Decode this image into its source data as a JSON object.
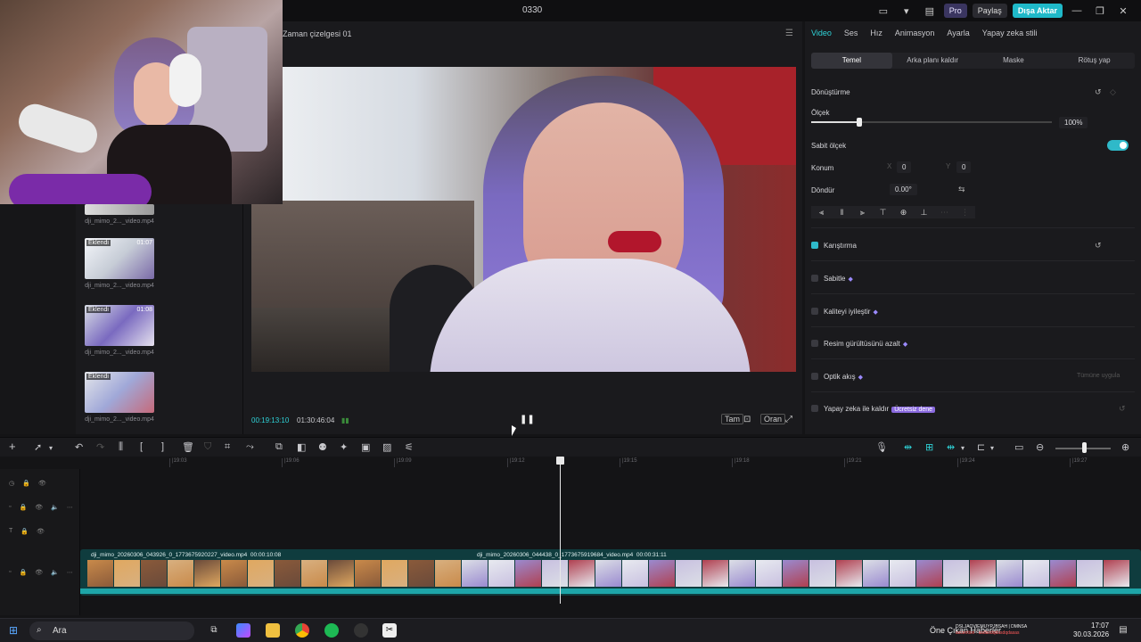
{
  "window": {
    "title": "0330"
  },
  "titlebar": {
    "pro": "Pro",
    "share": "Paylaş",
    "export": "Dışa Aktar"
  },
  "player": {
    "title": "Zaman çizelgesi 01",
    "current_time": "00:19:13:10",
    "total_time": "01:30:46:04",
    "full_btn": "Tam",
    "ratio_btn": "Oran"
  },
  "media": {
    "clips": [
      {
        "name": "dji_mimo_2..._video.mp4",
        "badge": "",
        "duration": ""
      },
      {
        "name": "dji_mimo_2..._video.mp4",
        "badge": "Eklendi",
        "duration": "01:07"
      },
      {
        "name": "dji_mimo_2..._video.mp4",
        "badge": "Eklendi",
        "duration": "01:08"
      },
      {
        "name": "dji_mimo_2..._video.mp4",
        "badge": "Eklendi",
        "duration": ""
      }
    ]
  },
  "inspector": {
    "tabs": [
      "Video",
      "Ses",
      "Hız",
      "Animasyon",
      "Ayarla",
      "Yapay zeka stili"
    ],
    "subtabs": [
      "Temel",
      "Arka planı kaldır",
      "Maske",
      "Rötuş yap"
    ],
    "transform": "Dönüştürme",
    "scale": "Ölçek",
    "scale_value": "100%",
    "scale_level": 0.2,
    "uniform_scale": "Sabit ölçek",
    "position": "Konum",
    "pos_x_label": "X",
    "pos_x": "0",
    "pos_y_label": "Y",
    "pos_y": "0",
    "rotate": "Döndür",
    "rotate_value": "0.00°",
    "blend": "Karıştırma",
    "stabilize": "Sabitle",
    "enhance": "Kaliteyi iyileştir",
    "denoise": "Resim gürültüsünü azalt",
    "optical_flow": "Optik akış",
    "apply_all": "Tümüne uygula",
    "ai_remove": "Yapay zeka ile kaldır",
    "free_badge": "Ücretsiz dene"
  },
  "timeline": {
    "ticks": [
      "|19:03",
      "|19:06",
      "|19:09",
      "|19:12",
      "|19:15",
      "|19:18",
      "|19:21",
      "|19:24",
      "|19:27"
    ],
    "clip1": {
      "name": "dji_mimo_20260306_043926_0_1773675920227_video.mp4",
      "duration": "00:00:10:08"
    },
    "clip2": {
      "name": "dji_mimo_20260306_044438_0_1773675919684_video.mp4",
      "duration": "00:00:31:11"
    }
  },
  "taskbar": {
    "search": "Ara",
    "news": "Öne Çıkan Haberler",
    "time": "17:07",
    "date": "30.03.2026",
    "overlay_line1": "DSLJAQVIEMUYPJBSAH | DMNSA",
    "overlay_line2": "ascention : asdasdqdasdqdasas"
  }
}
